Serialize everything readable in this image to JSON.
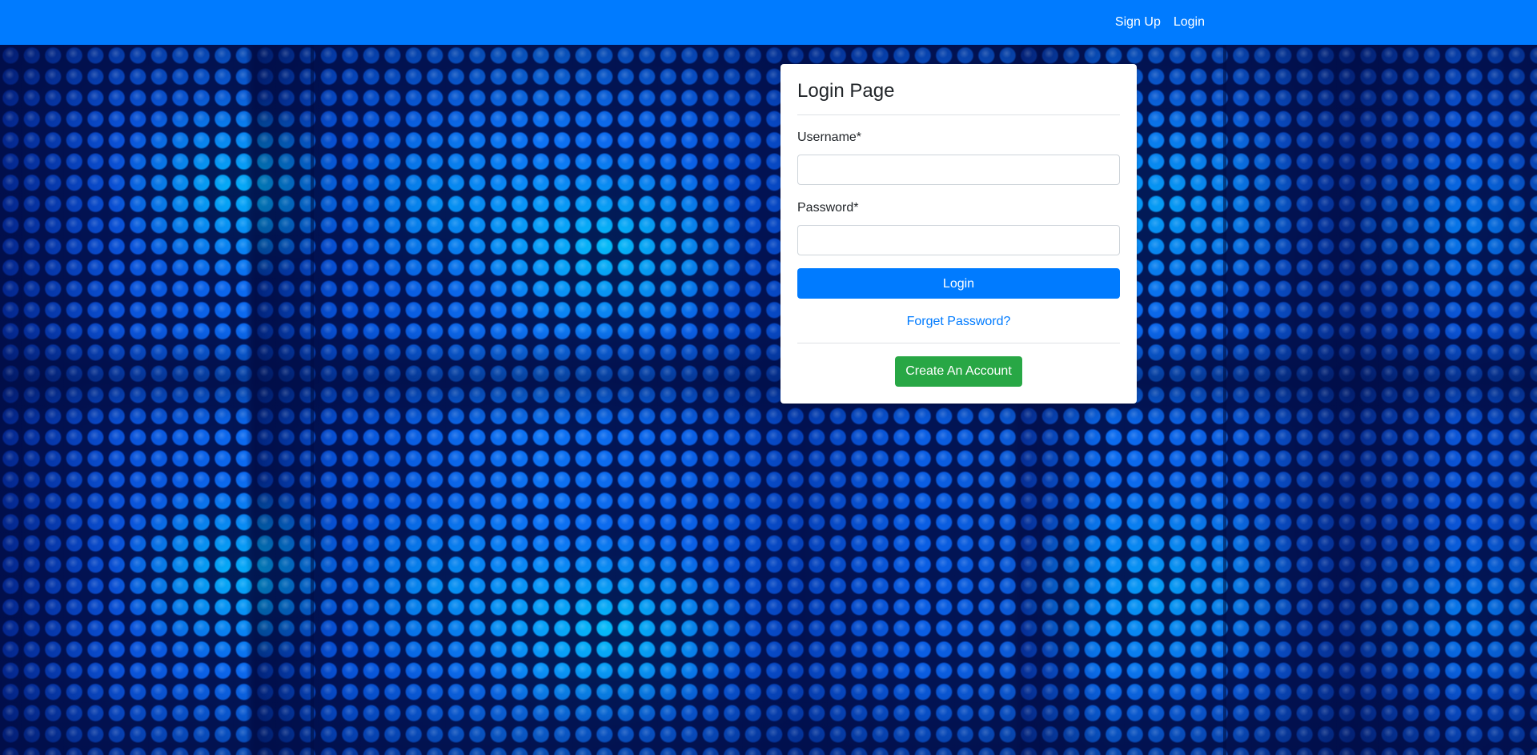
{
  "navbar": {
    "links": [
      "Sign Up",
      "Login"
    ]
  },
  "login_card": {
    "title": "Login Page",
    "username_label": "Username*",
    "username_value": "",
    "password_label": "Password*",
    "password_value": "",
    "login_button": "Login",
    "forgot_link": "Forget Password?",
    "create_account_button": "Create An Account"
  },
  "colors": {
    "navbar": "#007bff",
    "primary_button": "#007bff",
    "success_button": "#28a745",
    "background": "#0a5ee4"
  },
  "icons": []
}
